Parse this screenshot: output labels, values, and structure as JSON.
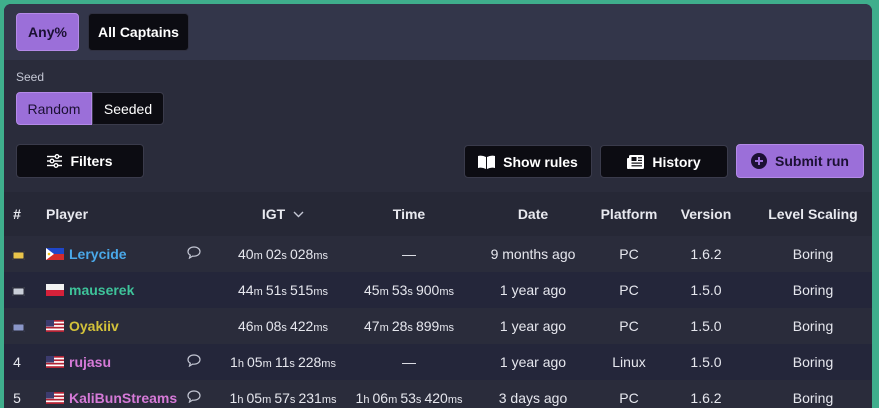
{
  "categories": {
    "any": "Any%",
    "all_captains": "All Captains"
  },
  "seed": {
    "label": "Seed",
    "random": "Random",
    "seeded": "Seeded"
  },
  "toolbar": {
    "filters": "Filters",
    "show_rules": "Show rules",
    "history": "History",
    "submit_run": "Submit run"
  },
  "table": {
    "headers": [
      "#",
      "Player",
      "IGT",
      "Time",
      "Date",
      "Platform",
      "Version",
      "Level Scaling"
    ],
    "rows": [
      {
        "rank": "",
        "medal": "gold",
        "flag": "philippines",
        "player": "Lerycide",
        "comment": true,
        "igt": [
          "40",
          "m ",
          "02",
          "s ",
          "028",
          "ms"
        ],
        "time": "—",
        "date": "9 months ago",
        "platform": "PC",
        "version": "1.6.2",
        "level_scaling": "Boring"
      },
      {
        "rank": "",
        "medal": "silver",
        "flag": "poland",
        "player": "mauserek",
        "comment": false,
        "igt": [
          "44",
          "m ",
          "51",
          "s ",
          "515",
          "ms"
        ],
        "time": [
          "45",
          "m ",
          "53",
          "s ",
          "900",
          "ms"
        ],
        "date": "1 year ago",
        "platform": "PC",
        "version": "1.5.0",
        "level_scaling": "Boring"
      },
      {
        "rank": "",
        "medal": "bronze",
        "flag": "usa",
        "player": "Oyakiiv",
        "comment": false,
        "igt": [
          "46",
          "m ",
          "08",
          "s ",
          "422",
          "ms"
        ],
        "time": [
          "47",
          "m ",
          "28",
          "s ",
          "899",
          "ms"
        ],
        "date": "1 year ago",
        "platform": "PC",
        "version": "1.5.0",
        "level_scaling": "Boring"
      },
      {
        "rank": "4",
        "medal": "",
        "flag": "usa",
        "player": "rujasu",
        "comment": true,
        "igt": [
          "1",
          "h ",
          "05",
          "m ",
          "11",
          "s ",
          "228",
          "ms"
        ],
        "time": "—",
        "date": "1 year ago",
        "platform": "Linux",
        "version": "1.5.0",
        "level_scaling": "Boring"
      },
      {
        "rank": "5",
        "medal": "",
        "flag": "usa",
        "player": "KaliBunStreams",
        "comment": true,
        "igt": [
          "1",
          "h ",
          "05",
          "m ",
          "57",
          "s ",
          "231",
          "ms"
        ],
        "time": [
          "1",
          "h ",
          "06",
          "m ",
          "53",
          "s ",
          "420",
          "ms"
        ],
        "date": "3 days ago",
        "platform": "PC",
        "version": "1.6.2",
        "level_scaling": "Boring"
      }
    ]
  },
  "colors": {
    "accent": "#9b6fd9",
    "panel": "#2a2c3b",
    "frame": "#3fae8c"
  }
}
